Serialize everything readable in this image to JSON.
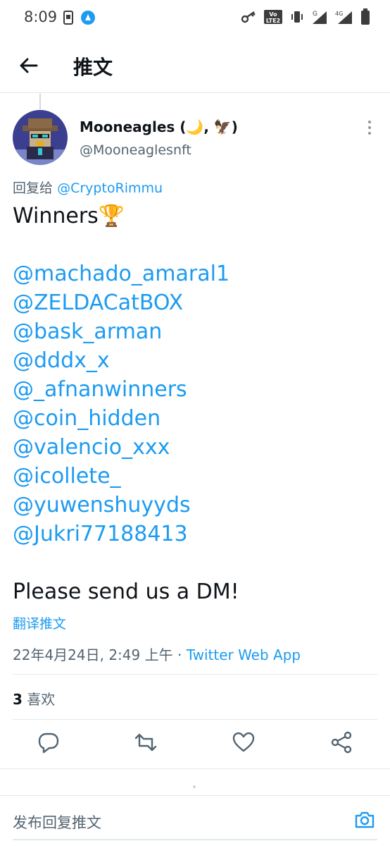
{
  "status_bar": {
    "time": "8:09",
    "icons": [
      "sim-card-icon",
      "app-notification-icon",
      "key-icon",
      "volte-icon",
      "vibrate-icon",
      "signal-g-icon",
      "signal-4g-icon",
      "battery-icon"
    ],
    "volte_text": "Vo LTE2",
    "network_g": "G",
    "network_4g": "4G"
  },
  "header": {
    "title": "推文"
  },
  "tweet": {
    "author": {
      "name": "Mooneagles (🌙, 🦅)",
      "handle": "@Mooneaglesnft"
    },
    "reply_to": {
      "prefix": "回复给",
      "mention": "@CryptoRimmu"
    },
    "body": {
      "heading": "Winners🏆",
      "mentions": [
        "@machado_amaral1",
        "@ZELDACatBOX",
        "@bask_arman",
        "@dddx_x",
        "@_afnanwinners",
        "@coin_hidden",
        "@valencio_xxx",
        "@icollete_",
        "@yuwenshuyyds",
        "@Jukri77188413"
      ],
      "closing": "Please send us a DM!"
    },
    "translate_label": "翻译推文",
    "timestamp": "22年4月24日, 2:49 上午",
    "separator": "·",
    "source": "Twitter Web App",
    "likes_count": "3",
    "likes_label": "喜欢"
  },
  "actions": [
    "reply-icon",
    "retweet-icon",
    "like-icon",
    "share-icon"
  ],
  "compose": {
    "placeholder": "发布回复推文"
  },
  "colors": {
    "accent": "#1d9bf0",
    "text": "#0f1419",
    "secondary": "#536471",
    "divider": "#e1e8ed"
  }
}
